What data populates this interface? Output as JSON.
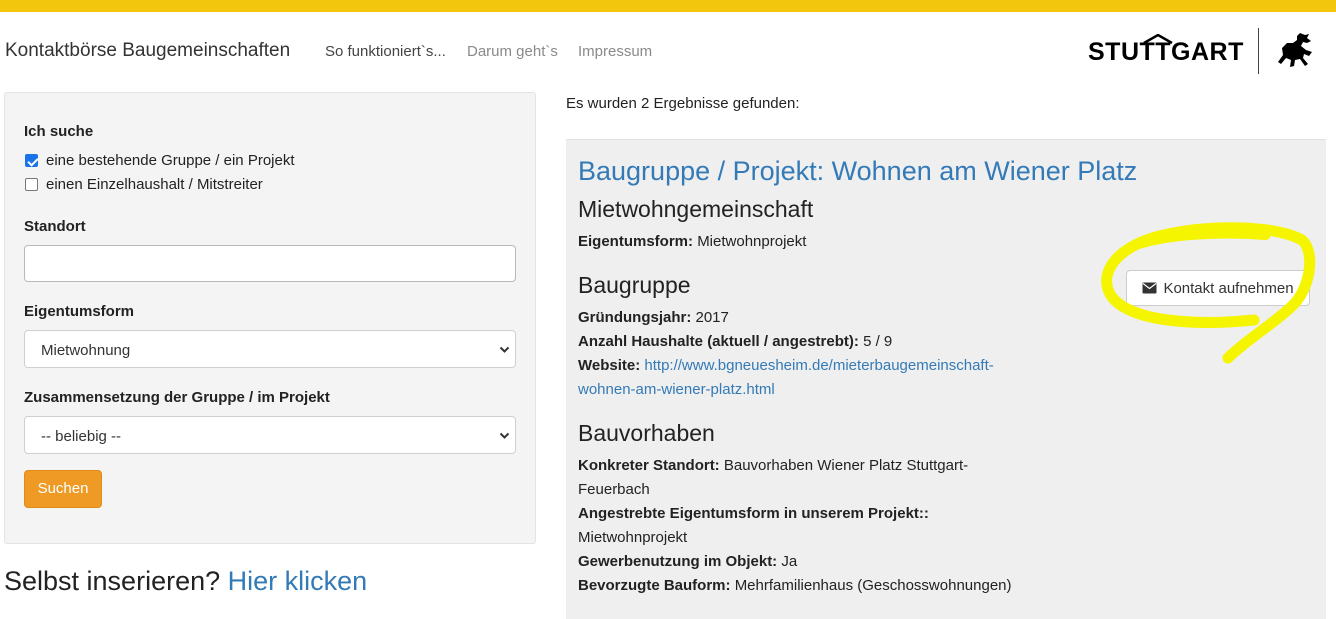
{
  "header": {
    "brand": "Kontaktbörse Baugemeinschaften",
    "nav": [
      {
        "label": "So funktioniert`s..."
      },
      {
        "label": "Darum geht`s"
      },
      {
        "label": "Impressum"
      }
    ],
    "logo_text": "STUTTGART",
    "accent_color": "#f3c60e"
  },
  "search": {
    "section_label": "Ich suche",
    "options": [
      {
        "label": "eine bestehende Gruppe / ein Projekt",
        "checked": true
      },
      {
        "label": "einen Einzelhaushalt / Mitstreiter",
        "checked": false
      }
    ],
    "location_label": "Standort",
    "location_value": "",
    "ownership_label": "Eigentumsform",
    "ownership_value": "Mietwohnung",
    "composition_label": "Zusammensetzung der Gruppe / im Projekt",
    "composition_value": "-- beliebig --",
    "submit_label": "Suchen",
    "button_color": "#ee9a25"
  },
  "self_insert": {
    "prompt": "Selbst inserieren?",
    "link": "Hier klicken"
  },
  "results": {
    "count_text": "Es wurden 2 Ergebnisse gefunden:",
    "card": {
      "title": "Baugruppe / Projekt: Wohnen am Wiener Platz",
      "subtitle": "Mietwohngemeinschaft",
      "ownership_label": "Eigentumsform:",
      "ownership_value": "Mietwohnprojekt",
      "contact_button": "Kontakt aufnehmen",
      "group_heading": "Baugruppe",
      "founded_label": "Gründungsjahr:",
      "founded_value": "2017",
      "households_label": "Anzahl Haushalte (aktuell / angestrebt):",
      "households_value": "5 / 9",
      "website_label": "Website:",
      "website_line1": "http://www.bgneuesheim.de/mieterbaugemeinschaft-",
      "website_line2": "wohnen-am-wiener-platz.html",
      "project_heading": "Bauvorhaben",
      "site_label": "Konkreter Standort:",
      "site_value_line1": "Bauvorhaben Wiener Platz Stuttgart-",
      "site_value_line2": "Feuerbach",
      "target_ownership_label": "Angestrebte Eigentumsform in unserem Projekt::",
      "target_ownership_value": "Mietwohnprojekt",
      "commercial_label": "Gewerbenutzung im Objekt:",
      "commercial_value": "Ja",
      "building_label": "Bevorzugte Bauform:",
      "building_value": "Mehrfamilienhaus (Geschosswohnungen)"
    },
    "link_color": "#337ab7",
    "highlight_color": "#f5f500"
  }
}
